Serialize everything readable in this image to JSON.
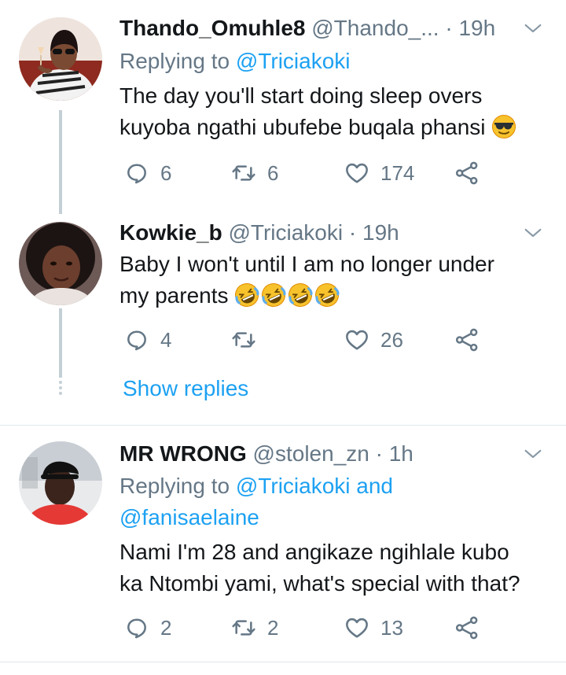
{
  "tweets": [
    {
      "name": "Thando_Omuhle8",
      "handle": "@Thando_...",
      "sep": " ·",
      "time": "19h",
      "replying_prefix": "Replying to ",
      "replying_to": "@Triciakoki",
      "text_line1": "The day you'll start doing sleep overs",
      "text_line2": "kuyoba ngathi ubufebe buqala phansi",
      "replies": "6",
      "retweets": "6",
      "likes": "174"
    },
    {
      "name": "Kowkie_b",
      "handle": "@Triciakoki",
      "sep": " ·",
      "time": "19h",
      "text_line1": "Baby I won't until I am no longer under",
      "text_line2": "my parents",
      "replies": "4",
      "retweets": "",
      "likes": "26"
    },
    {
      "name": "MR WRONG",
      "handle": "@stolen_zn",
      "sep": " ·",
      "time": "1h",
      "replying_prefix": "Replying to ",
      "replying_to": "@Triciakoki",
      "replying_and": " and",
      "replying_to2": "@fanisaelaine",
      "text_line1": "Nami I'm 28 and angikaze ngihlale kubo",
      "text_line2": "ka Ntombi yami, what's special with that?",
      "replies": "2",
      "retweets": "2",
      "likes": "13"
    }
  ],
  "show_replies": "Show replies",
  "icons": {
    "reply": "reply-icon",
    "retweet": "retweet-icon",
    "like": "heart-icon",
    "share": "share-icon",
    "menu": "chevron-down-icon",
    "emoji_cool": "sunglasses-emoji",
    "emoji_laugh": "rolling-laughing-emoji"
  },
  "colors": {
    "link": "#1da1f2",
    "muted": "#657786",
    "text": "#14171a",
    "thread_line": "#c4cfd6"
  }
}
